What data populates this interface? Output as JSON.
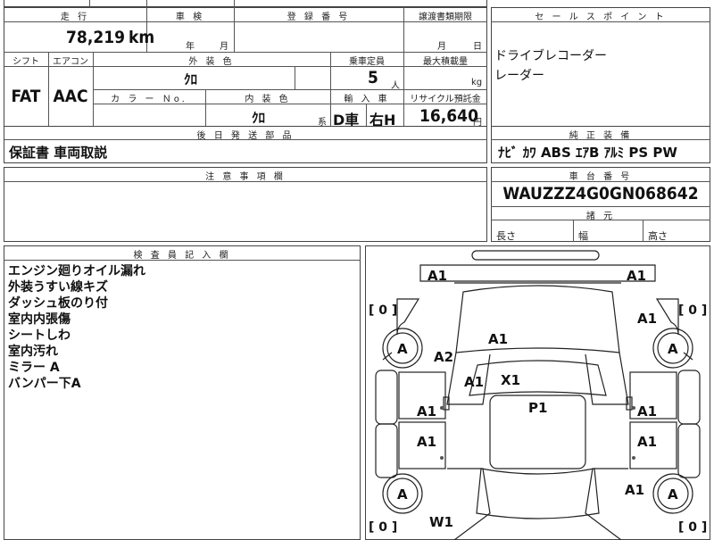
{
  "top_table": {
    "mileage_header": "走 行",
    "mileage_value": "78,219",
    "mileage_unit": "km",
    "inspection_header": "車 検",
    "inspection_year": "年",
    "inspection_month": "月",
    "registration_header": "登 録 番 号",
    "transfer_header": "譲渡書類期限",
    "transfer_month": "月",
    "transfer_day": "日",
    "shift_header": "シフト",
    "shift_value": "FAT",
    "ac_header": "エアコン",
    "ac_value": "AAC",
    "exterior_header": "外 装 色",
    "exterior_value": "ｸﾛ",
    "capacity_header": "乗車定員",
    "capacity_value": "5",
    "capacity_unit": "人",
    "load_header": "最大積載量",
    "load_unit": "kg",
    "color_no_header": "カ ラ ー Ｎo.",
    "interior_header": "内 装 色",
    "interior_value": "ｸﾛ",
    "interior_suffix": "系",
    "import_header": "輸 入 車",
    "import_type": "D車",
    "import_steering": "右H",
    "recycle_header": "リサイクル預託金",
    "recycle_value": "16,640",
    "recycle_unit": "円",
    "later_parts_header": "後 日 発 送 部 品",
    "later_parts_value": "保証書 車両取説"
  },
  "sales_points": {
    "header": "セ ー ル ス ポ イ ン ト",
    "lines": [
      "ドライブレコーダー",
      "レーダー"
    ]
  },
  "equipment": {
    "header": "純 正 装 備",
    "value": "ﾅﾋﾞ ｶﾜ ABS ｴｱB ｱﾙﾐ PS PW"
  },
  "chassis": {
    "header": "車 台 番 号",
    "value": "WAUZZZ4G0GN068642"
  },
  "dimensions": {
    "header": "諸 元",
    "length": "長さ",
    "width": "幅",
    "height": "高さ"
  },
  "notes": {
    "header": "注 意 事 項 欄"
  },
  "inspector": {
    "header": "検 査 員 記 入 欄",
    "lines": [
      "エンジン廻りオイル漏れ",
      "外装うすい線キズ",
      "ダッシュ板のり付",
      "室内内張傷",
      "シートしわ",
      "室内汚れ",
      "ミラー A",
      "バンパー下A"
    ]
  },
  "diagram": {
    "marks": {
      "front_left": "A1",
      "front_right": "A1",
      "right_front_fender": "A1",
      "hood": "A1",
      "left_a_pillar": "A2",
      "left_windshield": "A1",
      "windshield": "X1",
      "roof": "P1",
      "left_front_door": "A1",
      "right_front_door": "A1",
      "left_rear_door": "A1",
      "right_rear_door": "A1",
      "right_rear_fender": "A1",
      "rear_left": "W1",
      "wheel_fl": "A",
      "wheel_fr": "A",
      "wheel_rl": "A",
      "wheel_rr": "A"
    },
    "bracket_fl": "[ 0 ]",
    "bracket_fr": "[ 0 ]",
    "bracket_rl": "[ 0 ]",
    "bracket_rr": "[ 0 ]"
  }
}
